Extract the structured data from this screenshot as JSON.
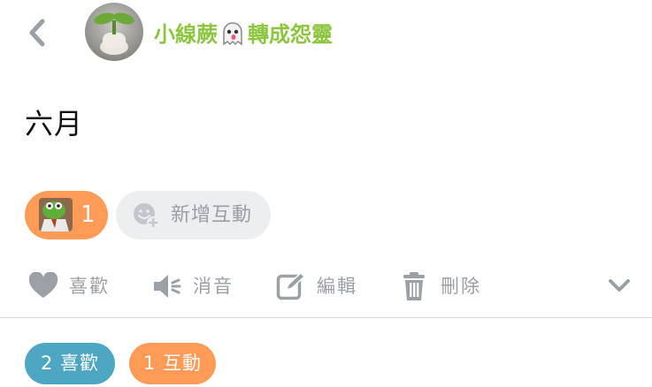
{
  "header": {
    "author_name_part1": "小線蕨",
    "ghost_icon": "ghost-emoji-icon",
    "author_name_part2": "轉成怨靈",
    "name_color": "#8cc63f"
  },
  "post": {
    "text": "六月"
  },
  "reactions": {
    "count": "1",
    "pill_color": "#ff9a57",
    "add_label": "新增互動"
  },
  "actions": {
    "like_label": "喜歡",
    "mute_label": "消音",
    "edit_label": "編輯",
    "delete_label": "刪除",
    "icon_color": "#9aa0a6"
  },
  "summary": {
    "likes_label": "2 喜歡",
    "interactions_label": "1 互動",
    "likes_color": "#4da6c2",
    "interactions_color": "#ff9a57"
  }
}
